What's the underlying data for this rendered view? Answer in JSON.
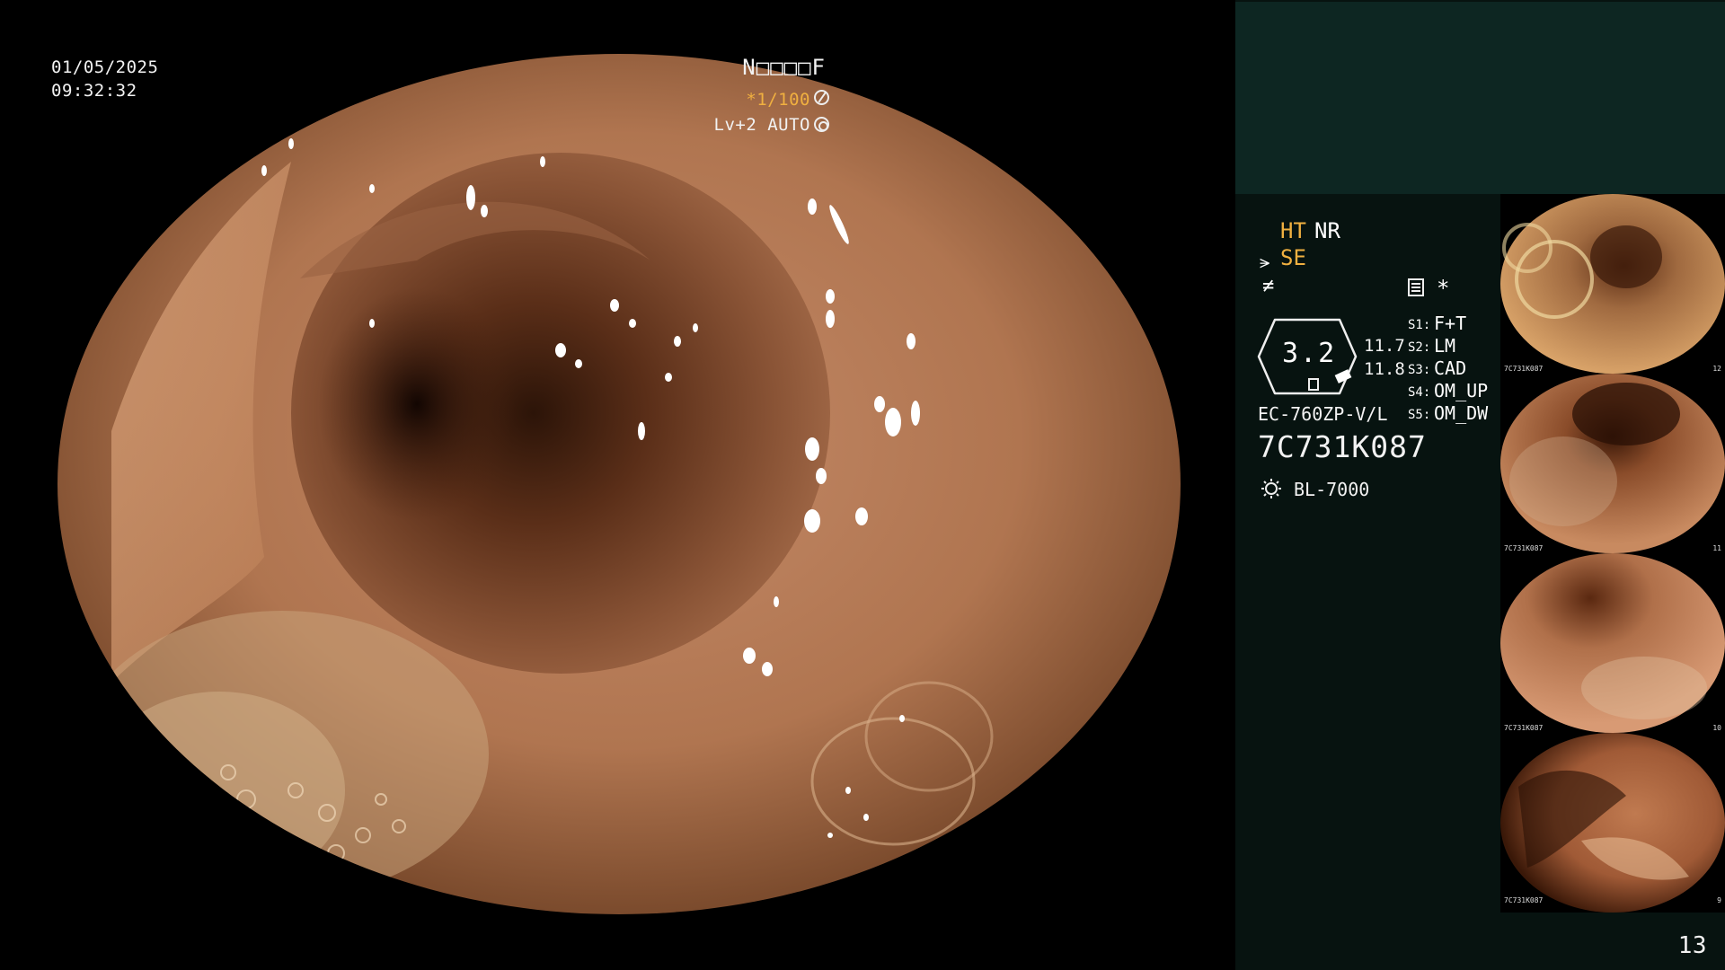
{
  "overlay": {
    "date": "01/05/2025",
    "time": "09:32:32",
    "code": "N□□□□F",
    "shutter": "*1/100",
    "level": "Lv+2 AUTO"
  },
  "panel": {
    "mode_ht": "HT",
    "mode_nr": "NR",
    "mode_se": "SE",
    "star": "*",
    "gauge_value": "3.2",
    "gauge_side_1": "11.7",
    "gauge_side_2": "11.8",
    "slots": [
      {
        "key": "S1:",
        "value": "F+T"
      },
      {
        "key": "S2:",
        "value": "LM"
      },
      {
        "key": "S3:",
        "value": "CAD"
      },
      {
        "key": "S4:",
        "value": "OM_UP"
      },
      {
        "key": "S5:",
        "value": "OM_DW"
      }
    ],
    "scope_model": "EC-760ZP-V/L",
    "serial": "7C731K087",
    "light_source": "BL-7000",
    "page_number": "13"
  },
  "thumbnails": [
    {
      "serial_label": "7C731K087",
      "index": "12"
    },
    {
      "serial_label": "7C731K087",
      "index": "11"
    },
    {
      "serial_label": "7C731K087",
      "index": "10"
    },
    {
      "serial_label": "7C731K087",
      "index": "9"
    }
  ],
  "icons": {
    "shutter": "aperture-icon",
    "level": "iris-icon",
    "se": "scope-tip-icon",
    "filter": "filter-icon",
    "memo": "memo-icon",
    "light": "light-bulb-icon"
  },
  "colors": {
    "accent": "#f0b040",
    "panel_bg": "#071310",
    "panel_top": "#0d2622"
  }
}
